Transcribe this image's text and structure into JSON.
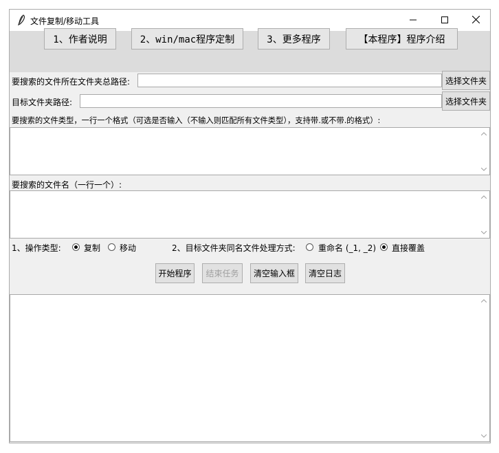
{
  "window": {
    "title": "文件复制/移动工具"
  },
  "top_buttons": [
    {
      "label": "1、作者说明"
    },
    {
      "label": "2、win/mac程序定制"
    },
    {
      "label": "3、更多程序"
    },
    {
      "label": "【本程序】程序介绍"
    }
  ],
  "source": {
    "label": "要搜索的文件所在文件夹总路径:",
    "value": "",
    "browse": "选择文件夹"
  },
  "target": {
    "label": "目标文件夹路径:",
    "value": "",
    "browse": "选择文件夹"
  },
  "filetypes": {
    "label": "要搜索的文件类型，一行一个格式（可选是否输入（不输入则匹配所有文件类型），支持带.或不带.的格式）:",
    "value": ""
  },
  "filenames": {
    "label": "要搜索的文件名（一行一个）:",
    "value": ""
  },
  "options": {
    "op_label": "1、操作类型:",
    "op_copy": "复制",
    "op_move": "移动",
    "op_selected": "复制",
    "dup_label": "2、目标文件夹同名文件处理方式:",
    "dup_rename": "重命名 (_1, _2)",
    "dup_overwrite": "直接覆盖",
    "dup_selected": "直接覆盖"
  },
  "actions": {
    "start": "开始程序",
    "stop": "结束任务",
    "clear_inputs": "清空输入框",
    "clear_log": "清空日志"
  },
  "log": {
    "value": ""
  }
}
